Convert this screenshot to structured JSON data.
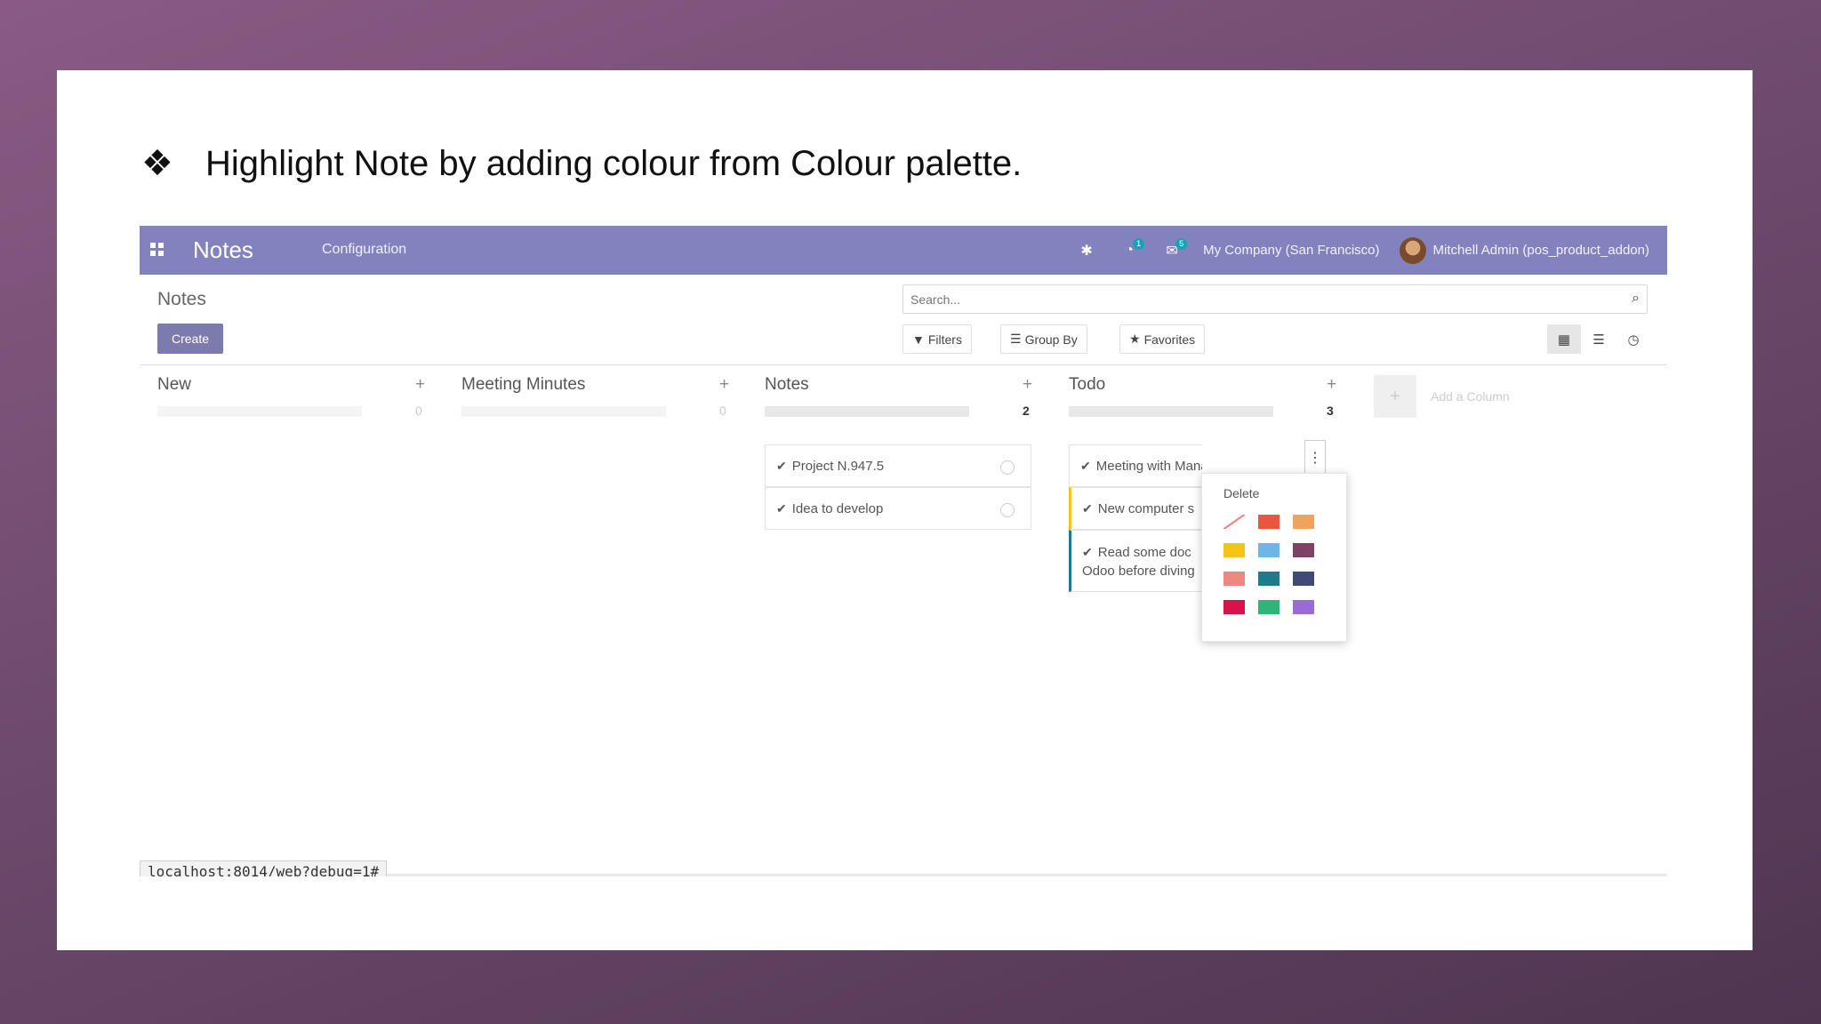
{
  "slide": {
    "bullet": "❖",
    "text": "Highlight Note by adding colour from Colour palette."
  },
  "navbar": {
    "apps_icon": "apps-grid-icon",
    "brand": "Notes",
    "menu": [
      "Configuration"
    ],
    "icons": [
      {
        "name": "bug-icon",
        "glyph": "✱",
        "badge": ""
      },
      {
        "name": "activity-icon",
        "glyph": "◔",
        "badge": "1"
      },
      {
        "name": "chat-icon",
        "glyph": "✉",
        "badge": "5"
      }
    ],
    "company": "My Company (San Francisco)",
    "user": "Mitchell Admin (pos_product_addon)"
  },
  "control": {
    "breadcrumb": "Notes",
    "create_label": "Create",
    "search_placeholder": "Search...",
    "filters_label": "Filters",
    "groupby_label": "Group By",
    "favorites_label": "Favorites",
    "views": [
      "kanban-view-icon",
      "list-view-icon",
      "activity-view-icon"
    ]
  },
  "kanban": {
    "columns": [
      {
        "title": "New",
        "add": "+",
        "count": "0",
        "empty": true
      },
      {
        "title": "Meeting Minutes",
        "add": "+",
        "count": "0",
        "empty": true
      },
      {
        "title": "Notes",
        "add": "+",
        "count": "2",
        "empty": false
      },
      {
        "title": "Todo",
        "add": "+",
        "count": "3",
        "empty": false
      }
    ],
    "notes_cards": [
      "Project N.947.5",
      "Idea to develop"
    ],
    "todo_cards": [
      "Meeting with Manager",
      "New computer s",
      "Read some doc",
      "Odoo before diving"
    ],
    "add_column_label": "Add a Column",
    "add_column_icon": "+"
  },
  "popup": {
    "delete_label": "Delete",
    "colors": [
      "none",
      "#e9563b",
      "#f0a35e",
      "#f5c418",
      "#6cb7e6",
      "#7e4266",
      "#ea8a81",
      "#1e7a8d",
      "#3f4a78",
      "#d8134b",
      "#2fb579",
      "#9a6ad6"
    ]
  },
  "statusbar": {
    "url": "localhost:8014/web?debug=1#"
  }
}
